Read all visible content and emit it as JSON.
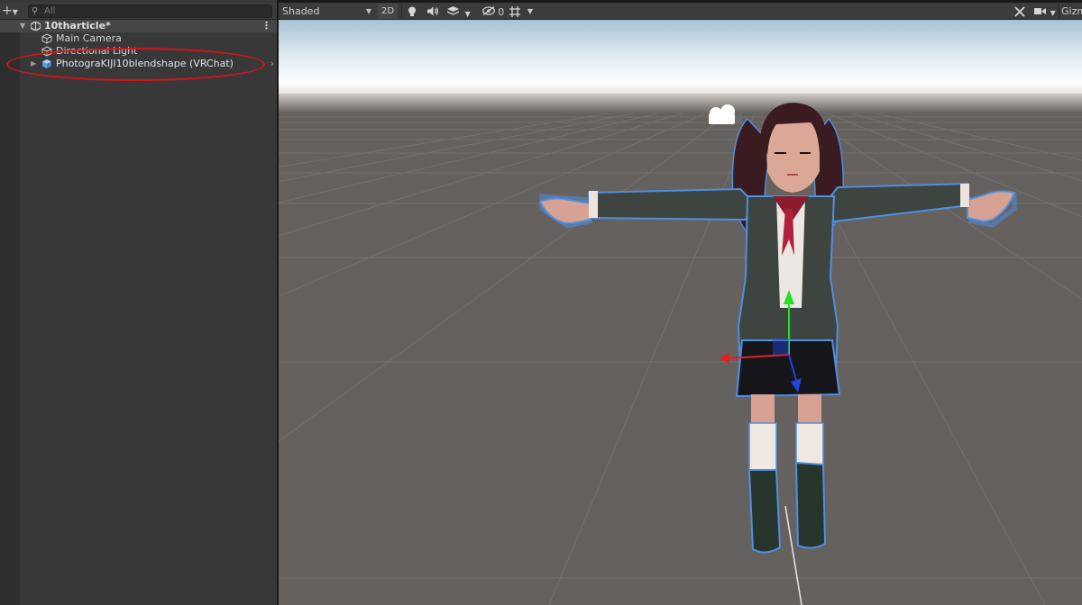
{
  "hierarchy": {
    "add_label": "+",
    "search_placeholder": "All",
    "scene": {
      "name": "10tharticle*",
      "menu": "⋮"
    },
    "items": [
      {
        "label": "Main Camera",
        "icon": "gameobject-cube-icon"
      },
      {
        "label": "Directional Light",
        "icon": "gameobject-cube-icon"
      },
      {
        "label": "PhotograKIJI10blendshape (VRChat)",
        "icon": "prefab-cube-icon",
        "expandable": true
      }
    ],
    "annotation_color": "#d81419"
  },
  "scene_view": {
    "toolbar": {
      "draw_mode": "Shaded",
      "mode_2d": "2D",
      "hidden_count": "0",
      "gizmos": "Gizmos"
    },
    "colors": {
      "sky_top": "#a3bfd2",
      "horizon": "#ffffff",
      "ground": "#65615e",
      "selection_outline": "#4f8fe0",
      "axis_x": "#e12222",
      "axis_y": "#22e022",
      "axis_z": "#2244e0"
    }
  }
}
